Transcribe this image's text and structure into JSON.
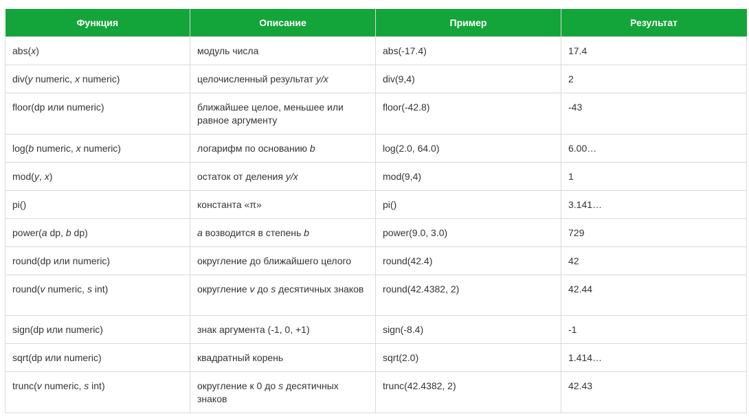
{
  "colors": {
    "header_bg": "#14a53a",
    "header_text": "#ffffff",
    "border": "#d9d9d9",
    "body_text": "#333333"
  },
  "table": {
    "headers": [
      "Функция",
      "Описание",
      "Пример",
      "Результат"
    ],
    "rows": [
      {
        "function": [
          {
            "t": "abs("
          },
          {
            "t": "x",
            "i": true
          },
          {
            "t": ")"
          }
        ],
        "description": [
          {
            "t": "модуль числа"
          }
        ],
        "example": "abs(-17.4)",
        "result": "17.4"
      },
      {
        "function": [
          {
            "t": "div("
          },
          {
            "t": "y",
            "i": true
          },
          {
            "t": " numeric, "
          },
          {
            "t": "x",
            "i": true
          },
          {
            "t": " numeric)"
          }
        ],
        "description": [
          {
            "t": "целочисленный результат "
          },
          {
            "t": "y/x",
            "i": true
          }
        ],
        "example": "div(9,4)",
        "result": "2"
      },
      {
        "function": [
          {
            "t": "floor(dp или numeric)"
          }
        ],
        "description": [
          {
            "t": "ближайшее целое, меньшее или равное аргументу"
          }
        ],
        "example": "floor(-42.8)",
        "result": "-43",
        "tall": true
      },
      {
        "function": [
          {
            "t": "log("
          },
          {
            "t": "b",
            "i": true
          },
          {
            "t": " numeric, "
          },
          {
            "t": "x",
            "i": true
          },
          {
            "t": " numeric)"
          }
        ],
        "description": [
          {
            "t": "логарифм по основанию "
          },
          {
            "t": "b",
            "i": true
          }
        ],
        "example": "log(2.0, 64.0)",
        "result": "6.00…"
      },
      {
        "function": [
          {
            "t": "mod("
          },
          {
            "t": "y",
            "i": true
          },
          {
            "t": ", "
          },
          {
            "t": "x",
            "i": true
          },
          {
            "t": ")"
          }
        ],
        "description": [
          {
            "t": "остаток от деления "
          },
          {
            "t": "y/x",
            "i": true
          }
        ],
        "example": "mod(9,4)",
        "result": "1"
      },
      {
        "function": [
          {
            "t": "pi()"
          }
        ],
        "description": [
          {
            "t": "константа «π»"
          }
        ],
        "example": "pi()",
        "result": "3.141…"
      },
      {
        "function": [
          {
            "t": "power("
          },
          {
            "t": "a",
            "i": true
          },
          {
            "t": " dp, "
          },
          {
            "t": "b",
            "i": true
          },
          {
            "t": " dp)"
          }
        ],
        "description": [
          {
            "t": "a",
            "i": true
          },
          {
            "t": " возводится в степень "
          },
          {
            "t": "b",
            "i": true
          }
        ],
        "example": "power(9.0, 3.0)",
        "result": "729"
      },
      {
        "function": [
          {
            "t": "round(dp или numeric)"
          }
        ],
        "description": [
          {
            "t": "округление до ближайшего целого"
          }
        ],
        "example": "round(42.4)",
        "result": "42"
      },
      {
        "function": [
          {
            "t": "round("
          },
          {
            "t": "v",
            "i": true
          },
          {
            "t": " numeric, "
          },
          {
            "t": "s",
            "i": true
          },
          {
            "t": " int)"
          }
        ],
        "description": [
          {
            "t": "округление "
          },
          {
            "t": "v",
            "i": true
          },
          {
            "t": " до "
          },
          {
            "t": "s",
            "i": true
          },
          {
            "t": " десятичных знаков"
          }
        ],
        "example": "round(42.4382, 2)",
        "result": "42.44",
        "tall": true
      },
      {
        "function": [
          {
            "t": "sign(dp или numeric)"
          }
        ],
        "description": [
          {
            "t": "знак аргумента (-1, 0, +1)"
          }
        ],
        "example": "sign(-8.4)",
        "result": "-1"
      },
      {
        "function": [
          {
            "t": "sqrt(dp или numeric)"
          }
        ],
        "description": [
          {
            "t": "квадратный корень"
          }
        ],
        "example": "sqrt(2.0)",
        "result": "1.414…"
      },
      {
        "function": [
          {
            "t": "trunc("
          },
          {
            "t": "v",
            "i": true
          },
          {
            "t": " numeric, "
          },
          {
            "t": "s",
            "i": true
          },
          {
            "t": " int)"
          }
        ],
        "description": [
          {
            "t": "округление к 0 до "
          },
          {
            "t": "s",
            "i": true
          },
          {
            "t": " десятичных знаков"
          }
        ],
        "example": "trunc(42.4382, 2)",
        "result": "42.43",
        "tall": true
      }
    ]
  }
}
